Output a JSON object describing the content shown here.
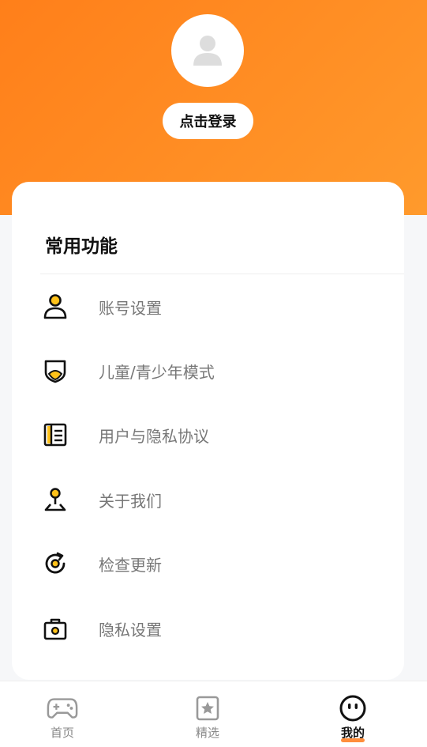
{
  "header": {
    "login_label": "点击登录"
  },
  "card": {
    "section_title": "常用功能",
    "items": [
      {
        "label": "账号设置",
        "icon": "person-icon"
      },
      {
        "label": "儿童/青少年模式",
        "icon": "shield-icon"
      },
      {
        "label": "用户与隐私协议",
        "icon": "agreement-book-icon"
      },
      {
        "label": "关于我们",
        "icon": "map-pin-icon"
      },
      {
        "label": "检查更新",
        "icon": "refresh-icon"
      },
      {
        "label": "隐私设置",
        "icon": "lock-bag-icon"
      }
    ]
  },
  "tabbar": {
    "tabs": [
      {
        "label": "首页",
        "icon": "gamepad-icon",
        "active": false
      },
      {
        "label": "精选",
        "icon": "star-badge-icon",
        "active": false
      },
      {
        "label": "我的",
        "icon": "face-icon",
        "active": true
      }
    ]
  },
  "colors": {
    "accent": "#ff8a22",
    "icon_fill": "#ffc21a"
  }
}
